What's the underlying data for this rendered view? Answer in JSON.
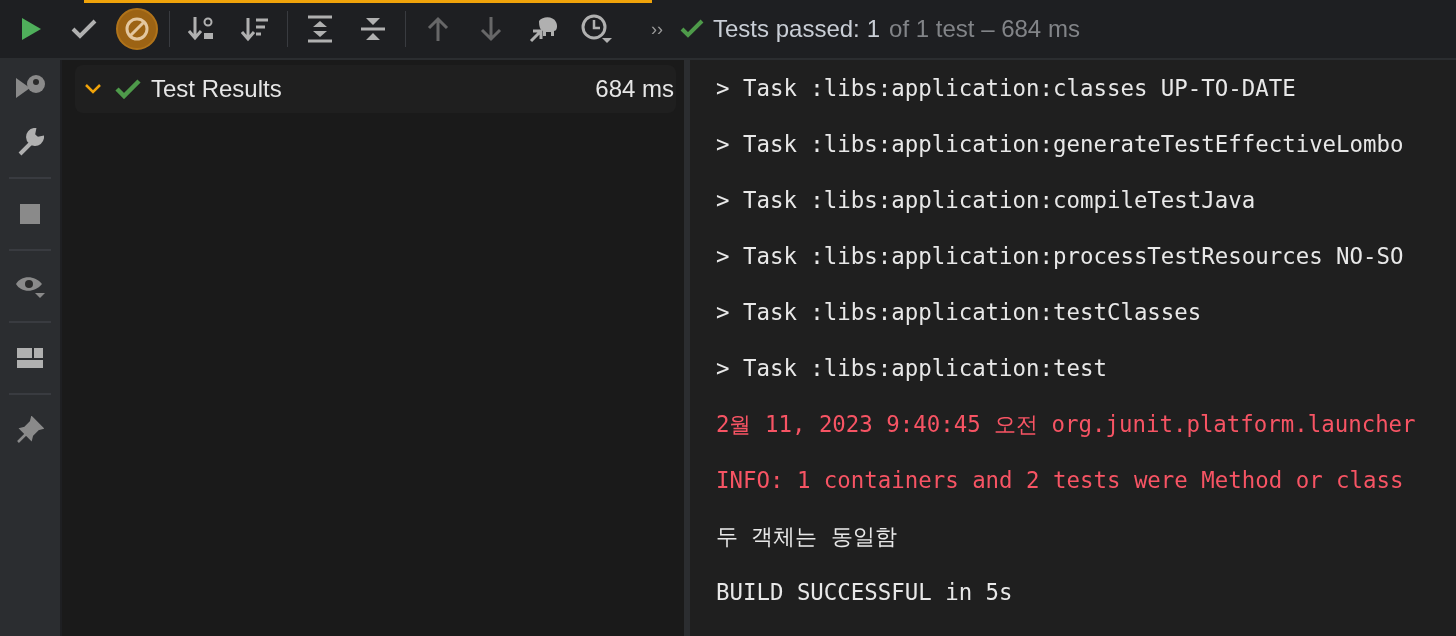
{
  "progress": {
    "level": 1
  },
  "toolbar": {
    "buttons": [
      {
        "kind": "run",
        "on": false,
        "disabled": false
      },
      {
        "kind": "passed",
        "on": false,
        "disabled": false
      },
      {
        "kind": "ignored",
        "on": true,
        "disabled": false
      },
      {
        "kind": "sep"
      },
      {
        "kind": "sort-alpha",
        "on": false,
        "disabled": false
      },
      {
        "kind": "sort-duration",
        "on": false,
        "disabled": false
      },
      {
        "kind": "sep"
      },
      {
        "kind": "expand",
        "on": false,
        "disabled": false
      },
      {
        "kind": "collapse",
        "on": false,
        "disabled": false
      },
      {
        "kind": "sep"
      },
      {
        "kind": "up",
        "on": false,
        "disabled": true
      },
      {
        "kind": "down",
        "on": false,
        "disabled": true
      },
      {
        "kind": "import",
        "on": false,
        "disabled": false
      },
      {
        "kind": "history",
        "on": false,
        "disabled": false
      }
    ],
    "overflow": "››"
  },
  "status": {
    "passed": true,
    "label": "Tests passed:",
    "count": "1",
    "detail": "of 1 test – 684 ms"
  },
  "sidebar": {
    "buttons": [
      {
        "kind": "rerun"
      },
      {
        "kind": "wrench"
      },
      {
        "kind": "sep"
      },
      {
        "kind": "stop"
      },
      {
        "kind": "sep"
      },
      {
        "kind": "eye"
      },
      {
        "kind": "sep"
      },
      {
        "kind": "layout"
      },
      {
        "kind": "sep"
      },
      {
        "kind": "pin"
      }
    ]
  },
  "tree": {
    "items": [
      {
        "label": "Test Results",
        "time": "684 ms",
        "passed": true,
        "expanded": true,
        "selected": false
      }
    ]
  },
  "console": {
    "lines": [
      {
        "kind": "normal",
        "text": "> Task :libs:application:classes UP-TO-DATE"
      },
      {
        "kind": "normal",
        "text": "> Task :libs:application:generateTestEffectiveLombo"
      },
      {
        "kind": "normal",
        "text": "> Task :libs:application:compileTestJava"
      },
      {
        "kind": "normal",
        "text": "> Task :libs:application:processTestResources NO-SO"
      },
      {
        "kind": "normal",
        "text": "> Task :libs:application:testClasses"
      },
      {
        "kind": "normal",
        "text": "> Task :libs:application:test"
      },
      {
        "kind": "error",
        "text": "2월 11, 2023 9:40:45 오전 org.junit.platform.launcher"
      },
      {
        "kind": "error",
        "text": "INFO: 1 containers and 2 tests were Method or class"
      },
      {
        "kind": "normal",
        "text": "두 객체는 동일함"
      },
      {
        "kind": "normal",
        "text": "BUILD SUCCESSFUL in 5s"
      }
    ]
  }
}
